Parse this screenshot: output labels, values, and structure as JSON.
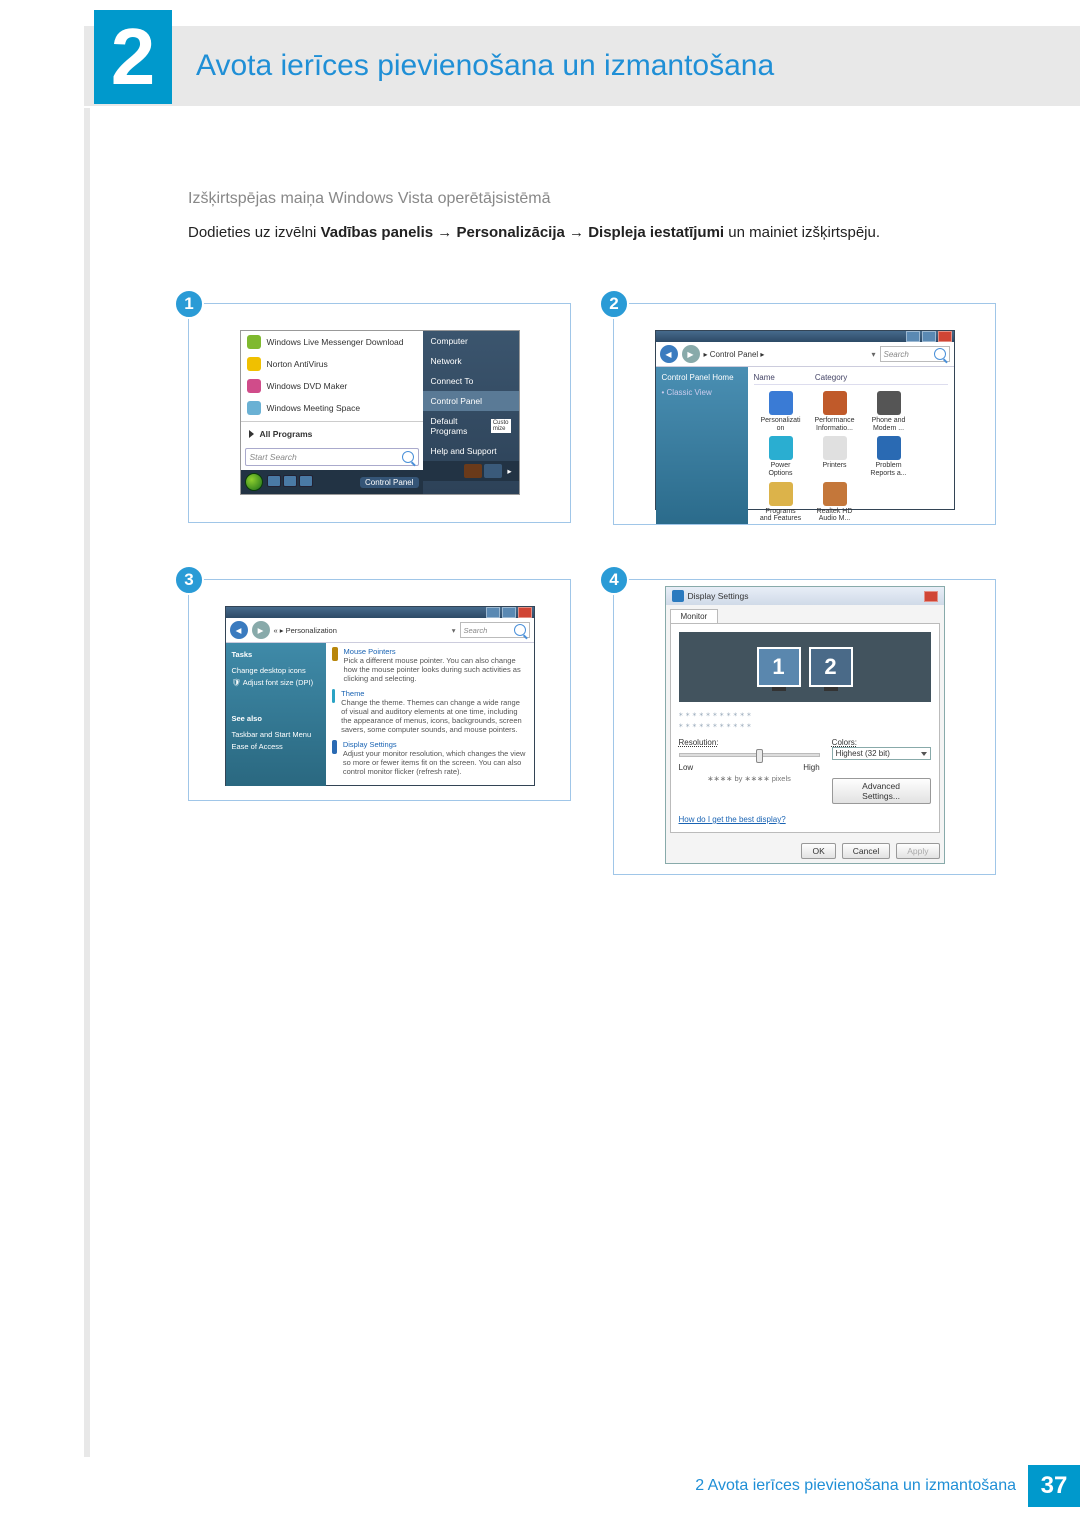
{
  "chapter": {
    "number": "2",
    "title": "Avota ierīces pievienošana un izmantošana"
  },
  "section_title": "Izšķirtspējas maiņa Windows Vista operētājsistēmā",
  "body": {
    "lead": "Dodieties uz izvēlni ",
    "bold1": "Vadības panelis",
    "arr": " → ",
    "bold2": "Personalizācija",
    "bold3": "Displeja iestatījumi",
    "tail": " un mainiet izšķirtspēju."
  },
  "badges": {
    "b1": "1",
    "b2": "2",
    "b3": "3",
    "b4": "4"
  },
  "startmenu": {
    "left_items": [
      "Windows Live Messenger Download",
      "Norton AntiVirus",
      "Windows DVD Maker",
      "Windows Meeting Space"
    ],
    "all_programs": "All Programs",
    "search_placeholder": "Start Search",
    "right_items": [
      "Computer",
      "Network",
      "Connect To",
      "Control Panel",
      "Default Programs",
      "Help and Support"
    ],
    "right_highlight": "Control Panel",
    "custo": "Custo\nmize",
    "task_label": "Control Panel"
  },
  "controlpanel": {
    "crumb": "▸ Control Panel ▸",
    "search_placeholder": "Search",
    "side": {
      "home": "Control Panel Home",
      "classic": "Classic View"
    },
    "headers": {
      "name": "Name",
      "category": "Category"
    },
    "icons": [
      {
        "label": "Personalizati\non",
        "color": "#3a7bd5"
      },
      {
        "label": "Performance\nInformatio...",
        "color": "#c05a2a"
      },
      {
        "label": "Phone and\nModem ...",
        "color": "#555"
      },
      {
        "label": "Power\nOptions",
        "color": "#2aaed1"
      },
      {
        "label": "Printers",
        "color": "#e0e0e0"
      },
      {
        "label": "Problem\nReports a...",
        "color": "#2a6ab3"
      },
      {
        "label": "Programs\nand Features",
        "color": "#dcb34a"
      },
      {
        "label": "Realtek HD\nAudio M...",
        "color": "#c4773a"
      }
    ]
  },
  "personalization": {
    "crumb": "« ▸ Personalization",
    "search_placeholder": "Search",
    "side": {
      "tasks": "Tasks",
      "opt1": "Change desktop icons",
      "opt2": "Adjust font size (DPI)",
      "seealso": "See also",
      "sa1": "Taskbar and Start Menu",
      "sa2": "Ease of Access"
    },
    "items": [
      {
        "title": "Mouse Pointers",
        "desc": "Pick a different mouse pointer. You can also change how the mouse pointer looks during such activities as clicking and selecting."
      },
      {
        "title": "Theme",
        "desc": "Change the theme. Themes can change a wide range of visual and auditory elements at one time, including the appearance of menus, icons, backgrounds, screen savers, some computer sounds, and mouse pointers."
      },
      {
        "title": "Display Settings",
        "desc": "Adjust your monitor resolution, which changes the view so more or fewer items fit on the screen. You can also control monitor flicker (refresh rate)."
      }
    ]
  },
  "displaysettings": {
    "title": "Display Settings",
    "tab": "Monitor",
    "mon1": "1",
    "mon2": "2",
    "stars1": "∗∗∗∗∗∗∗∗∗∗∗",
    "stars2": "∗∗∗∗∗∗∗∗∗∗∗",
    "resolution": "Resolution:",
    "low": "Low",
    "high": "High",
    "pixels": "∗∗∗∗ by ∗∗∗∗ pixels",
    "colors": "Colors:",
    "color_value": "Highest (32 bit)",
    "advanced": "Advanced Settings...",
    "help": "How do I get the best display?",
    "ok": "OK",
    "cancel": "Cancel",
    "apply": "Apply"
  },
  "footer": {
    "text": "2 Avota ierīces pievienošana un izmantošana",
    "page": "37"
  }
}
